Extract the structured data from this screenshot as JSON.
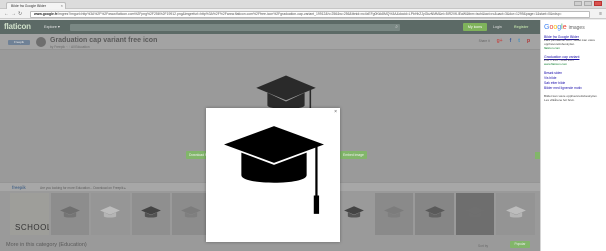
{
  "browser": {
    "tab_title": "Bilde fra Google Bilder",
    "url_host": "www.google.fr",
    "url_rest": "/imgres?imgurl=http%3A%2F%2Fwww.flaticon.com%2Fpng%2F256%2F19912.png&imgrefurl=http%3A%2F%2Fwww.flaticon.com%2Ffree-icon%2Fgraduation-cap-variant_19912&h=256&w=256&tbnid=nc4xEFg0Kkk8MQ%3A&docid=LPbHhZJyGkzNMM&ei=5IR2VfLlEaW&tbm=isch&iact=rc&uact=3&dur=1299&page=1&start=0&ndsp="
  },
  "site": {
    "logo_text": "flaticon",
    "explore_label": "Explore ▾",
    "my_icons_label": "My icons",
    "login_label": "Login",
    "register_label": "Register",
    "title": "Graduation cap variant free icon",
    "byline": "by Freepik · 🗎 All Education",
    "author_tag": "Freepik",
    "share_label": "Share it",
    "share_icons": [
      "g+",
      "f",
      "t",
      "p"
    ],
    "download_label": "Download PNG",
    "embed_label": "Embed image",
    "freepik_logo": "freepik",
    "freepik_text": "Are you looking for more Education... Download on Freepik ▸",
    "thumb_label": "SCHOOL",
    "more_title": "More in this category (Education)",
    "sort_label": "Sort by",
    "sort_button": "Popular"
  },
  "thumbnails": [
    {
      "bg": "#9e9e9a",
      "kind": "school"
    },
    {
      "bg": "#8d8d8d",
      "kind": "books"
    },
    {
      "bg": "#969696",
      "kind": "paper"
    },
    {
      "bg": "#8f8f8f",
      "kind": "cap"
    },
    {
      "bg": "#8c8c8c",
      "kind": "globe"
    },
    {
      "bg": "#7d7d7d",
      "kind": "cap"
    },
    {
      "bg": "#8e8e8e",
      "kind": "light"
    },
    {
      "bg": "#939393",
      "kind": "pencils"
    },
    {
      "bg": "#9a9a9a",
      "kind": "back"
    },
    {
      "bg": "#8a8a8a",
      "kind": "cap"
    },
    {
      "bg": "#868686",
      "kind": "grad"
    },
    {
      "bg": "#6e6e6e",
      "kind": "board"
    },
    {
      "bg": "#949494",
      "kind": "cup"
    }
  ],
  "google_panel": {
    "logo_google": [
      "G",
      "o",
      "o",
      "g",
      "l",
      "e"
    ],
    "logo_suffix": "images",
    "results": [
      {
        "title": "Bilde fra Google Bilder",
        "text": "Fant på flaticon.com. Bildet kan være opphavsrettsbeskyttet.",
        "url": "flaticon.com"
      },
      {
        "title": "Graduation cap variant",
        "text": "256 × 256 - Free icon",
        "url": "www.flaticon.com"
      }
    ],
    "links": [
      "Besøk siden",
      "Vis bilde",
      "Søk etter bilde",
      "Bilder med lignende motiv"
    ],
    "footer": "Bildet kan være opphavsrettsbeskyttet. Les vilkårene før bruk."
  },
  "colors": {
    "page_dim": "#9a9a9a",
    "header": "#5c6a66",
    "accent_green": "#82b66a",
    "modal_bg": "#ffffff",
    "icon": "#000000"
  }
}
